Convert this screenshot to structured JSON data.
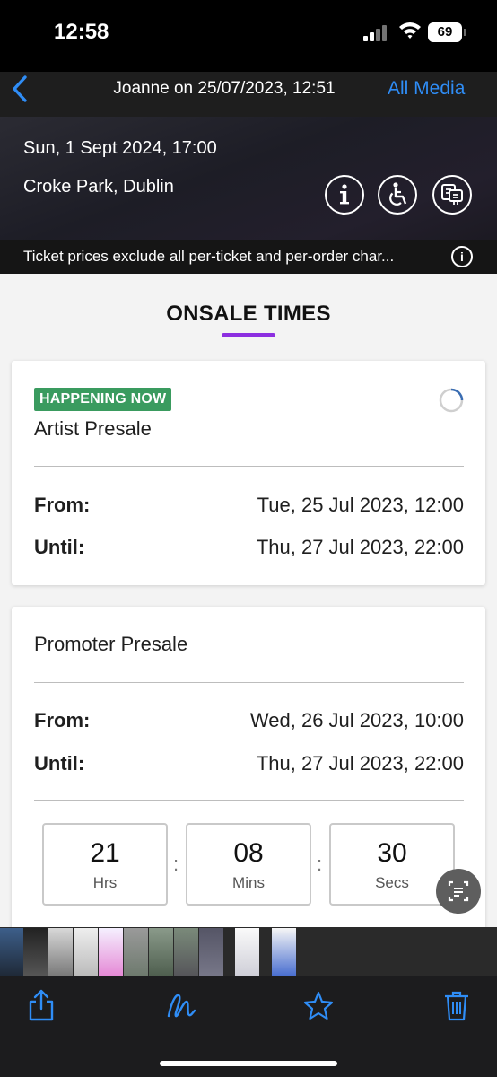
{
  "status_bar": {
    "time": "12:58",
    "battery": "69"
  },
  "nav": {
    "title": "Joanne on 25/07/2023, 12:51",
    "all_media": "All Media",
    "back_icon": "chevron-left-icon"
  },
  "event": {
    "date": "Sun, 1 Sept 2024, 17:00",
    "venue": "Croke Park, Dublin",
    "disclaimer": "Ticket prices exclude all per-ticket and per-order char...",
    "icons": [
      "info-icon",
      "accessibility-icon",
      "seat-map-icon"
    ]
  },
  "section": {
    "title": "ONSALE TIMES",
    "accent": "#8c2ee0"
  },
  "presales": [
    {
      "badge": "HAPPENING NOW",
      "name": "Artist Presale",
      "from_label": "From:",
      "from": "Tue, 25 Jul 2023, 12:00",
      "until_label": "Until:",
      "until": "Thu, 27 Jul 2023, 22:00"
    },
    {
      "name": "Promoter Presale",
      "from_label": "From:",
      "from": "Wed, 26 Jul 2023, 10:00",
      "until_label": "Until:",
      "until": "Thu, 27 Jul 2023, 22:00",
      "countdown": [
        {
          "value": "21",
          "unit": "Hrs"
        },
        {
          "value": "08",
          "unit": "Mins"
        },
        {
          "value": "30",
          "unit": "Secs"
        }
      ]
    }
  ],
  "colors": {
    "badge_green": "#3a9b5f",
    "ios_blue": "#2f8df6"
  },
  "toolbar": {
    "icons": [
      "share-icon",
      "markup-icon",
      "favorite-icon",
      "trash-icon"
    ]
  }
}
